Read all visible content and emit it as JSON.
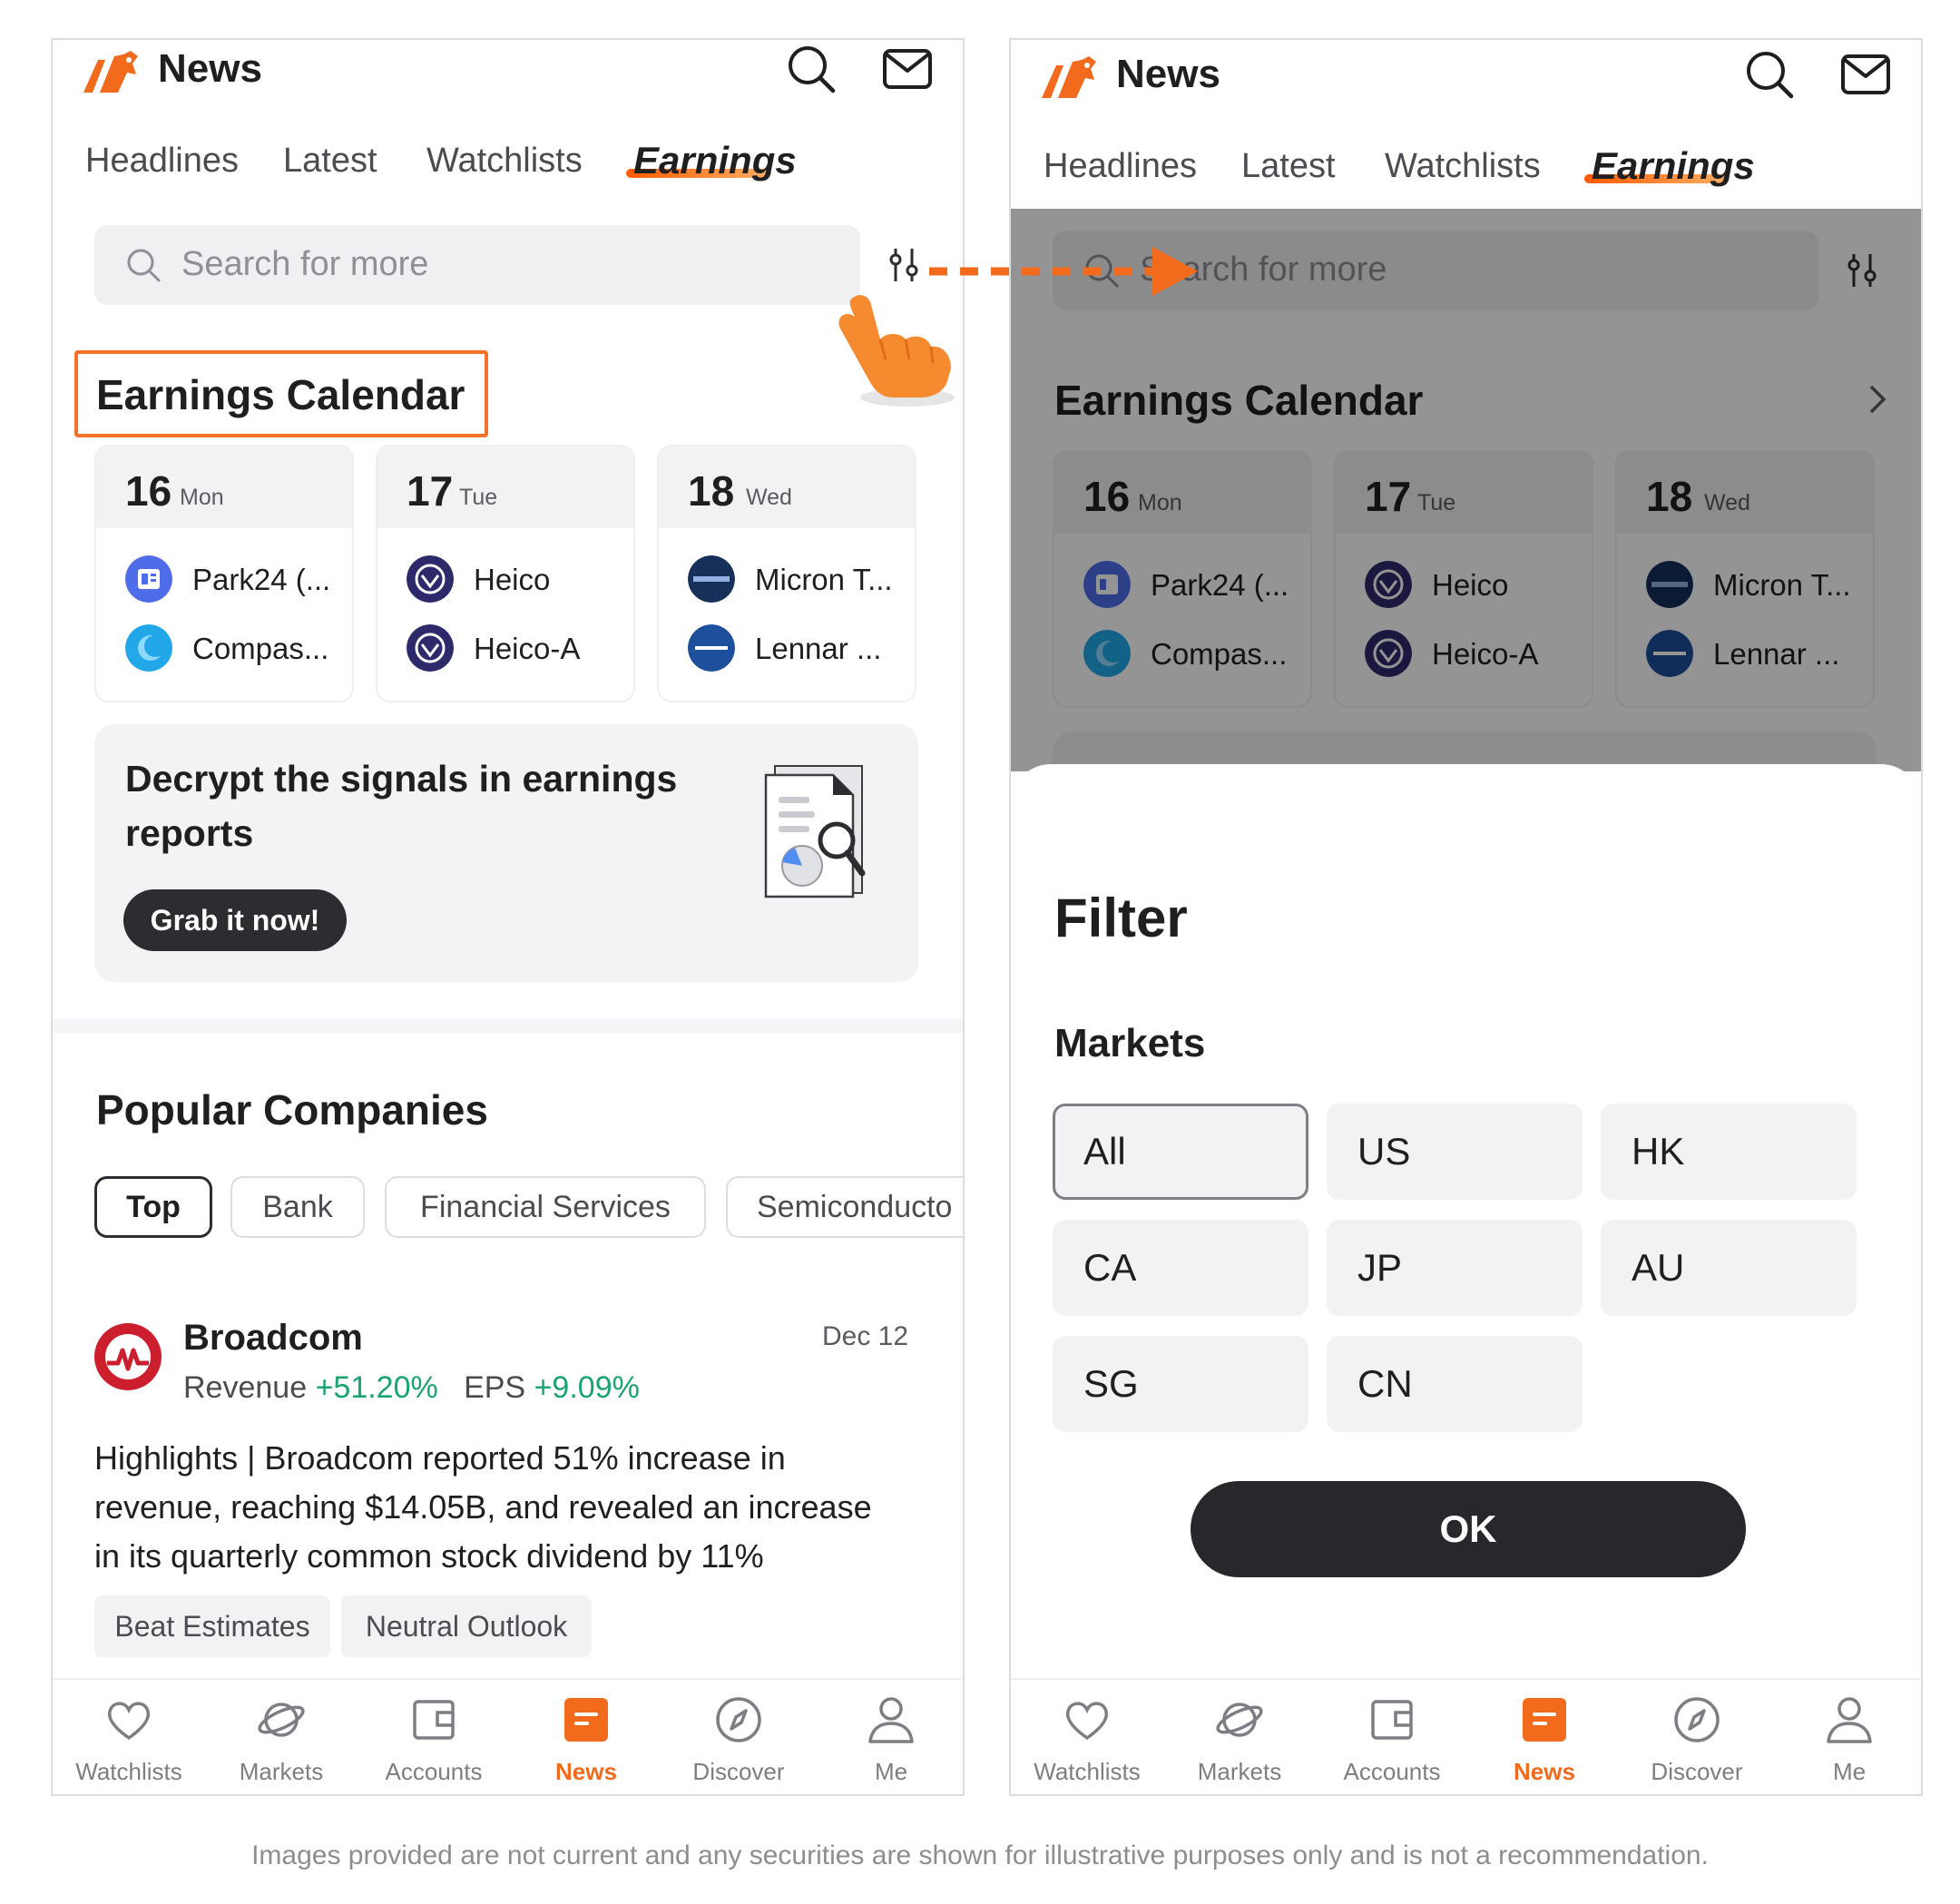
{
  "left": {
    "app_title": "News",
    "tabs": [
      "Headlines",
      "Latest",
      "Watchlists",
      "Earnings"
    ],
    "search_placeholder": "Search for more",
    "earnings_calendar": {
      "title": "Earnings Calendar",
      "days": [
        {
          "num": "16",
          "name": "Mon",
          "companies": [
            "Park24 (...",
            "Compas..."
          ]
        },
        {
          "num": "17",
          "name": "Tue",
          "companies": [
            "Heico",
            "Heico-A"
          ]
        },
        {
          "num": "18",
          "name": "Wed",
          "companies": [
            "Micron T...",
            "Lennar ..."
          ]
        }
      ]
    },
    "promo": {
      "line1": "Decrypt the signals in earnings",
      "line2": "reports",
      "button": "Grab it now!"
    },
    "popular": {
      "title": "Popular Companies",
      "chips": [
        "Top",
        "Bank",
        "Financial Services",
        "Semiconducto"
      ],
      "news": {
        "company": "Broadcom",
        "date": "Dec 12",
        "revenue_label": "Revenue",
        "revenue_value": "+51.20%",
        "eps_label": "EPS",
        "eps_value": "+9.09%",
        "body_line1": "Highlights | Broadcom reported 51% increase in",
        "body_line2": "revenue, reaching $14.05B, and revealed an increase",
        "body_line3": "in its quarterly common stock dividend by 11%",
        "tags": [
          "Beat Estimates",
          "Neutral Outlook"
        ]
      }
    }
  },
  "right": {
    "app_title": "News",
    "tabs": [
      "Headlines",
      "Latest",
      "Watchlists",
      "Earnings"
    ],
    "search_placeholder": "Search for more",
    "earnings_calendar": {
      "title": "Earnings Calendar",
      "days": [
        {
          "num": "16",
          "name": "Mon",
          "companies": [
            "Park24 (...",
            "Compas..."
          ]
        },
        {
          "num": "17",
          "name": "Tue",
          "companies": [
            "Heico",
            "Heico-A"
          ]
        },
        {
          "num": "18",
          "name": "Wed",
          "companies": [
            "Micron T...",
            "Lennar ..."
          ]
        }
      ]
    },
    "filter": {
      "title": "Filter",
      "section": "Markets",
      "markets": [
        "All",
        "US",
        "HK",
        "CA",
        "JP",
        "AU",
        "SG",
        "CN"
      ],
      "selected": "All",
      "ok": "OK"
    }
  },
  "bottom_nav": [
    "Watchlists",
    "Markets",
    "Accounts",
    "News",
    "Discover",
    "Me"
  ],
  "bottom_nav_active": "News",
  "disclaimer": "Images provided are not current and any securities are shown for illustrative purposes only and is not a recommendation.",
  "colors": {
    "accent": "#f26a1b",
    "positive": "#1aa46f",
    "dark_button": "#2b2d31"
  },
  "logo_colors": {
    "park24": "#4f6de8",
    "compass": "#22a7e8",
    "heico": "#2d2a6b",
    "micron": "#16305a",
    "lennar": "#1d4f9c",
    "broadcom": "#cc1f2d"
  }
}
